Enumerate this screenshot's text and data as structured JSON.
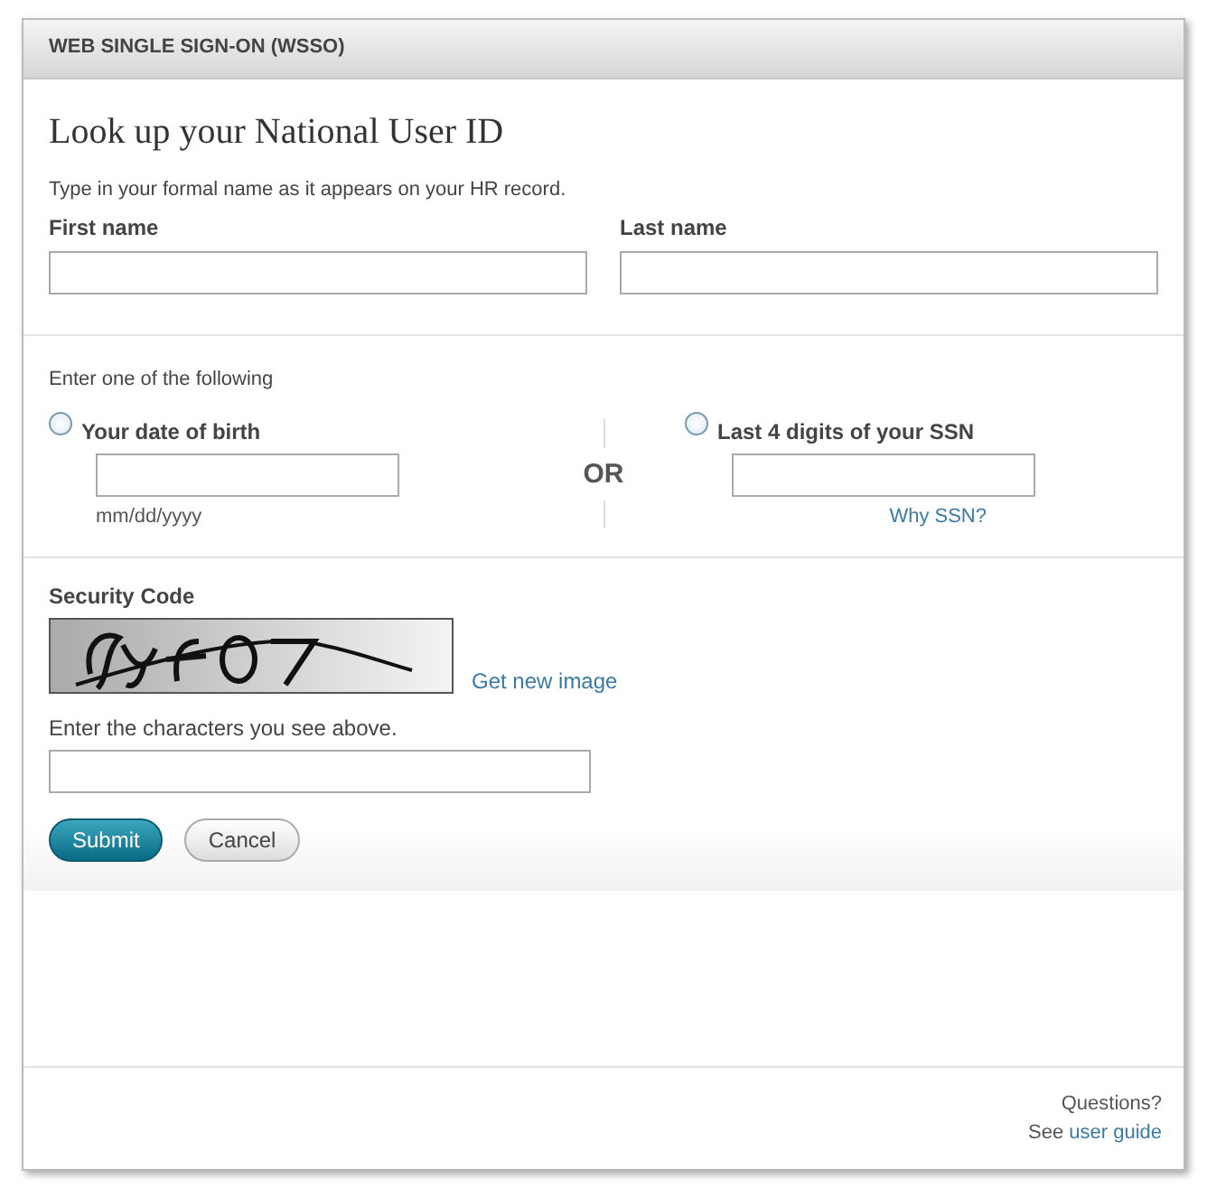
{
  "header": {
    "title": "WEB SINGLE SIGN-ON (WSSO)"
  },
  "heading": "Look up your National User ID",
  "intro": "Type in your formal name as it appears on your HR record.",
  "name_fields": [
    {
      "label": "First name"
    },
    {
      "label": "Last name"
    }
  ],
  "choice": {
    "prompt": "Enter one of the following",
    "separator": "OR",
    "options": [
      {
        "label": "Your date of birth",
        "selected": false,
        "hint": "mm/dd/yyyy"
      },
      {
        "label": "Last 4 digits of your SSN",
        "selected": false,
        "link": "Why SSN?"
      }
    ]
  },
  "security": {
    "label": "Security Code",
    "new_image_link": "Get new image",
    "prompt": "Enter the characters you see above."
  },
  "buttons": [
    {
      "label": "Submit",
      "kind": "primary"
    },
    {
      "label": "Cancel",
      "kind": "secondary"
    }
  ],
  "footer": {
    "question": "Questions?",
    "help_prefix": "See",
    "help_link": "user guide"
  }
}
